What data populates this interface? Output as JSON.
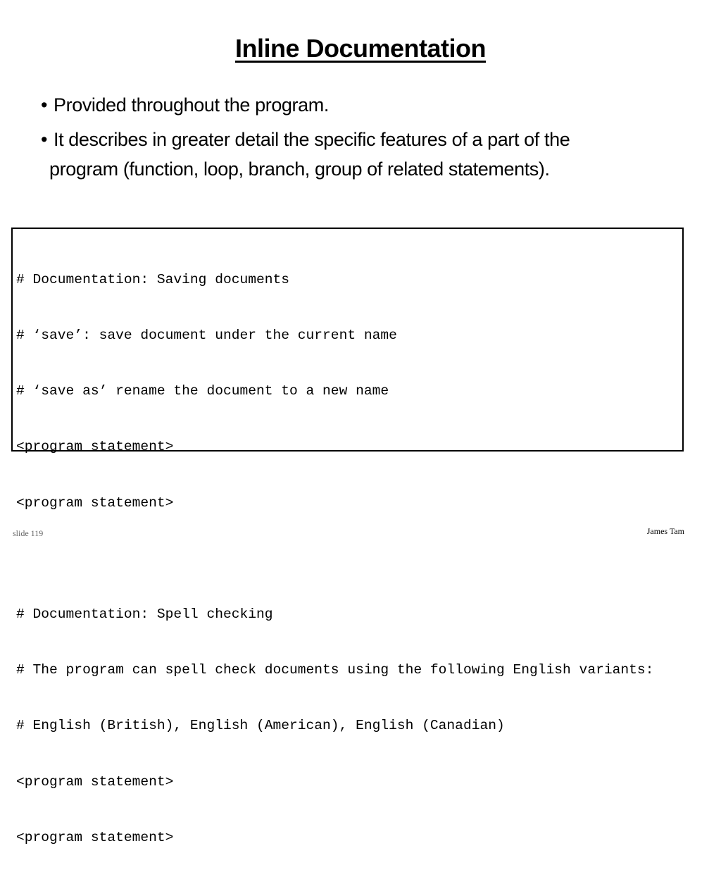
{
  "slide": {
    "title": "Inline Documentation",
    "bullet_glyph": "•",
    "bullets": [
      {
        "line1": "Provided throughout the program.",
        "line2": ""
      },
      {
        "line1": "It describes in greater detail the specific features of a part of the",
        "line2": "program (function, loop, branch, group of related statements)."
      }
    ],
    "code_example": {
      "lines": [
        "# Documentation: Saving documents",
        "# ‘save’: save document under the current name",
        "# ‘save as’ rename the document to a new name",
        "<program statement>",
        "<program statement>",
        "",
        "# Documentation: Spell checking",
        "# The program can spell check documents using the following English variants:",
        "# English (British), English (American), English (Canadian)",
        "<program statement>",
        "<program statement>"
      ]
    },
    "footer": {
      "slide_number": "slide 119",
      "author": "James Tam"
    }
  }
}
